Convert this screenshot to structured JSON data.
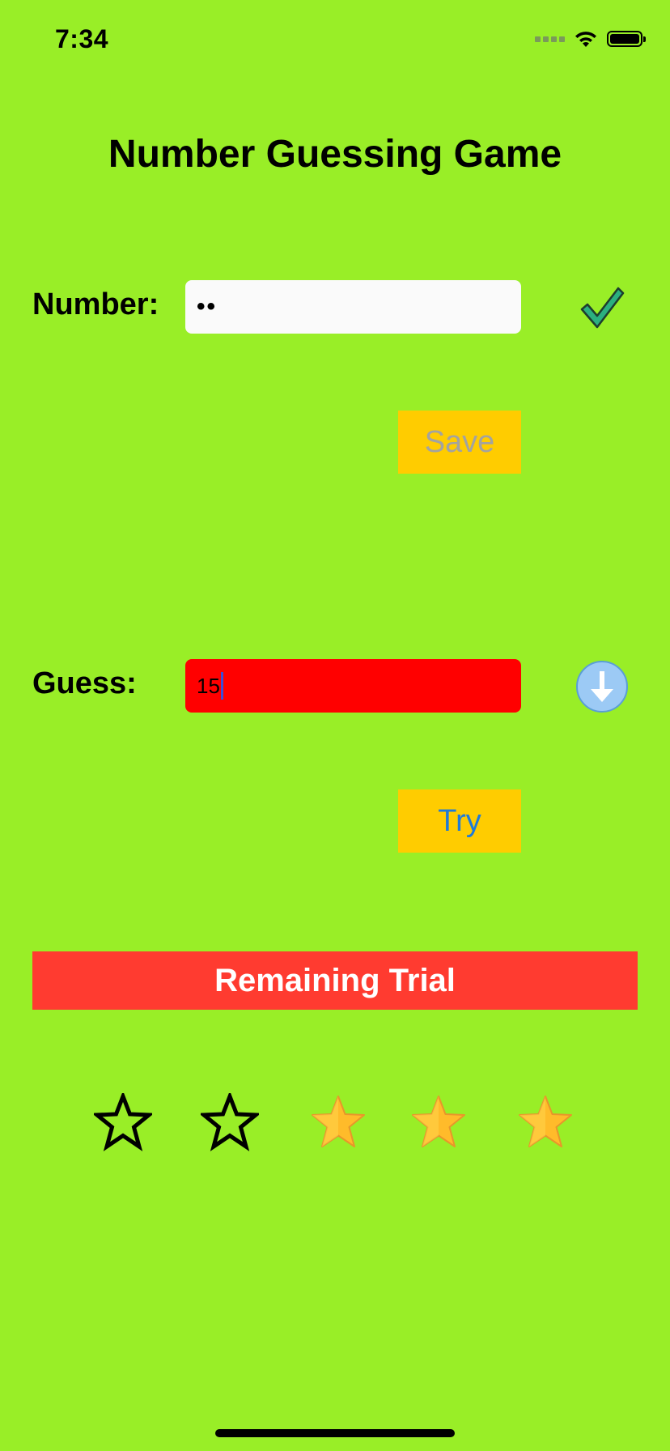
{
  "status_bar": {
    "time": "7:34"
  },
  "title": "Number Guessing Game",
  "number_row": {
    "label": "Number:",
    "value": "••",
    "status_icon": "checkmark-icon"
  },
  "save_button": {
    "label": "Save",
    "state": "disabled"
  },
  "guess_row": {
    "label": "Guess:",
    "value": "15",
    "status_icon": "arrow-down-circle-icon"
  },
  "try_button": {
    "label": "Try"
  },
  "remaining": {
    "label": "Remaining Trial",
    "total": 5,
    "filled": 3,
    "stars": [
      {
        "state": "empty"
      },
      {
        "state": "empty"
      },
      {
        "state": "filled"
      },
      {
        "state": "filled"
      },
      {
        "state": "filled"
      }
    ]
  },
  "colors": {
    "background": "#99ee27",
    "button": "#ffcc00",
    "banner": "#ff3b30",
    "guess_field": "#ff0000",
    "check": "#2bb07f",
    "star_gold": "#ffbb2a"
  }
}
